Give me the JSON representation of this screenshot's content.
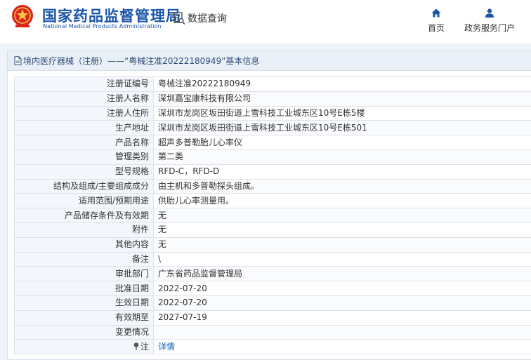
{
  "header": {
    "site_name_cn": "国家药品监督管理局",
    "site_name_en": "National Medical Products Administration",
    "logo_icon": "emblem-icon",
    "query_label": "数据查询",
    "nav": [
      {
        "label": "首页",
        "icon": "home-icon"
      },
      {
        "label": "政务服务门户",
        "icon": "user-icon"
      }
    ]
  },
  "panel": {
    "title": "境内医疗器械（注册）——“粤械注准20222180949”基本信息",
    "rows": [
      {
        "label": "注册证编号",
        "value": "粤械注准20222180949"
      },
      {
        "label": "注册人名称",
        "value": "深圳嘉宝康科技有限公司"
      },
      {
        "label": "注册人住所",
        "value": "深圳市龙岗区坂田街道上雪科技工业城东区10号E栋5楼"
      },
      {
        "label": "生产地址",
        "value": "深圳市龙岗区坂田街道上雪科技工业城东区10号E栋501"
      },
      {
        "label": "产品名称",
        "value": "超声多普勒胎儿心率仪"
      },
      {
        "label": "管理类别",
        "value": "第二类"
      },
      {
        "label": "型号规格",
        "value": "RFD-C，RFD-D"
      },
      {
        "label": "结构及组成/主要组成成分",
        "value": "由主机和多普勒探头组成。"
      },
      {
        "label": "适用范围/预期用途",
        "value": "供胎儿心率测量用。"
      },
      {
        "label": "产品储存条件及有效期",
        "value": "无"
      },
      {
        "label": "附件",
        "value": "无"
      },
      {
        "label": "其他内容",
        "value": "无"
      },
      {
        "label": "备注",
        "value": "\\"
      },
      {
        "label": "审批部门",
        "value": "广东省药品监督管理局"
      },
      {
        "label": "批准日期",
        "value": "2022-07-20"
      },
      {
        "label": "生效日期",
        "value": "2022-07-20"
      },
      {
        "label": "有效期至",
        "value": "2027-07-19"
      },
      {
        "label": "变更情况",
        "value": ""
      }
    ],
    "note": {
      "label": "注",
      "link_text": "详情",
      "icon": "pin-icon"
    }
  },
  "colors": {
    "brand_blue": "#1a55a8",
    "logo_red": "#d7261e",
    "link": "#1a63b8",
    "band_bg": "#eef3f9"
  }
}
